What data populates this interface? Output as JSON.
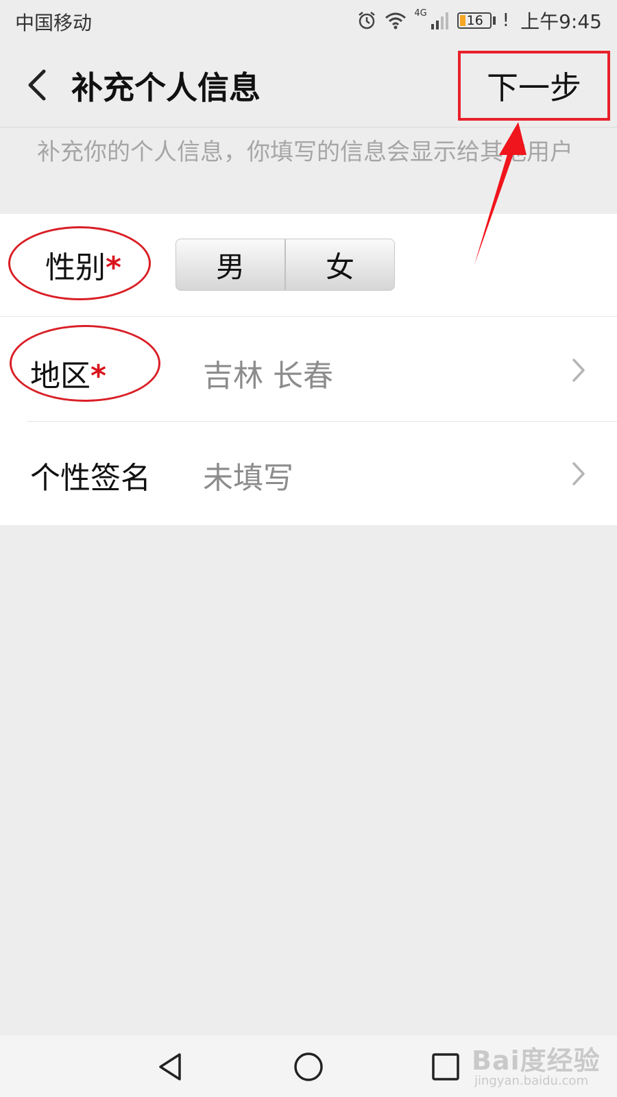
{
  "status_bar": {
    "carrier": "中国移动",
    "network": "4G",
    "battery": "16",
    "warning": "!",
    "time": "上午9:45"
  },
  "nav": {
    "title": "补充个人信息",
    "next_label": "下一步"
  },
  "hint": "补充你的个人信息，你填写的信息会显示给其他用户",
  "form": {
    "gender": {
      "label": "性别",
      "required_mark": "*",
      "options": [
        "男",
        "女"
      ]
    },
    "region": {
      "label": "地区",
      "required_mark": "*",
      "value": "吉林 长春"
    },
    "signature": {
      "label": "个性签名",
      "value": "未填写"
    }
  },
  "watermark": {
    "main": "Bai度经验",
    "sub": "jingyan.baidu.com"
  },
  "colors": {
    "annotation_red": "#e8202a",
    "background": "#ededed",
    "placeholder_gray": "#8c8c8c",
    "hint_gray": "#a6a6a6"
  }
}
